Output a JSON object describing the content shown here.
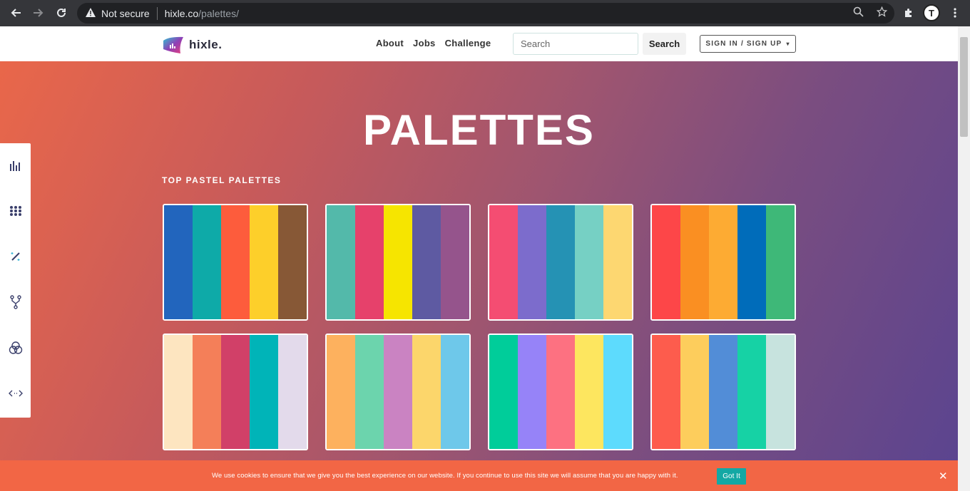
{
  "browser": {
    "security_label": "Not secure",
    "url_host": "hixle.co",
    "url_path": "/palettes/",
    "profile_initial": "T"
  },
  "header": {
    "logo_text": "hixle.",
    "nav": [
      "About",
      "Jobs",
      "Challenge"
    ],
    "search_placeholder": "Search",
    "search_button": "Search",
    "signin_label": "SIGN IN / SIGN UP",
    "signin_caret": "▾"
  },
  "hero": {
    "title": "PALETTES",
    "section_label": "TOP PASTEL PALETTES"
  },
  "palettes": [
    [
      "#2265bd",
      "#0eaaa8",
      "#fd5c3c",
      "#fdcf2a",
      "#875836"
    ],
    [
      "#53b9aa",
      "#e6416b",
      "#f6e500",
      "#5e5aa2",
      "#95548c"
    ],
    [
      "#f44d72",
      "#7c6ccc",
      "#2592b4",
      "#76d0c4",
      "#fdd771"
    ],
    [
      "#fd4648",
      "#fa8f22",
      "#fdab33",
      "#006cba",
      "#3eb878"
    ],
    [
      "#fde5c0",
      "#f47f59",
      "#d14068",
      "#00b4b8",
      "#e3daeb"
    ],
    [
      "#fdb15e",
      "#6cd4ad",
      "#ca83c2",
      "#fcd66b",
      "#6ec8ea"
    ],
    [
      "#00cd9a",
      "#9683f8",
      "#fd7181",
      "#fde65f",
      "#5ddbfd"
    ],
    [
      "#fd5c4d",
      "#fdcd5c",
      "#528dd7",
      "#16d2a5",
      "#c7e3de"
    ]
  ],
  "sidebar_tools": [
    {
      "icon": "bar-chart-icon"
    },
    {
      "icon": "grid-dots-icon"
    },
    {
      "icon": "magic-wand-icon"
    },
    {
      "icon": "fork-icon"
    },
    {
      "icon": "color-circles-icon"
    },
    {
      "icon": "code-icon"
    }
  ],
  "cookie": {
    "text": "We use cookies to ensure that we give you the best experience on our website. If you continue to use this site we will assume that you are happy with it.",
    "ok_label": "Got It",
    "close_glyph": "✕"
  }
}
